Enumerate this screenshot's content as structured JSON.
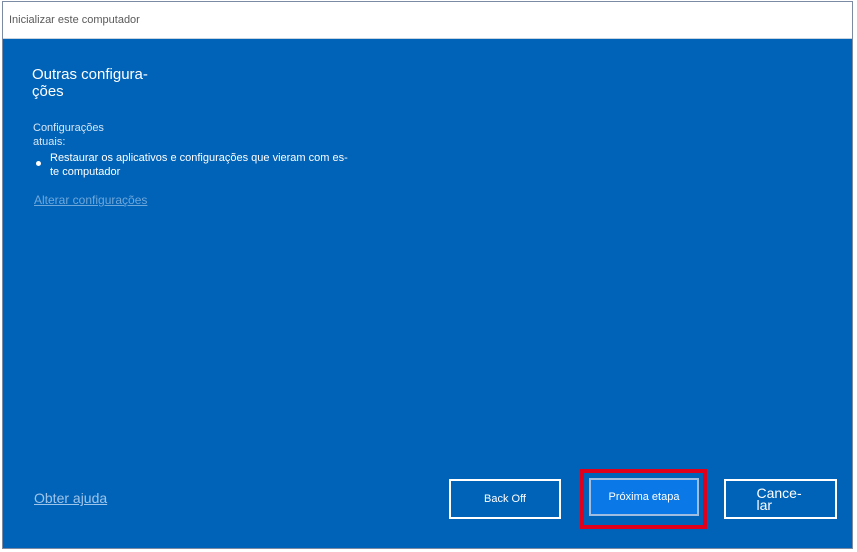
{
  "window": {
    "title": "Inicializar este computador"
  },
  "main": {
    "heading": "Outras configura-ções",
    "current_settings_label": "Configurações atuais:",
    "settings_items": [
      "Restaurar os aplicativos e configurações que vieram com es-te computador"
    ],
    "change_settings_link": "Alterar configurações"
  },
  "footer": {
    "help_link": "Obter ajuda",
    "back_button": "Back Off",
    "next_button": "Próxima etapa",
    "cancel_button": "Cance-lar"
  },
  "colors": {
    "background": "#0063b8",
    "highlight_border": "#e0001b",
    "next_button_bg": "#0a78e6"
  }
}
